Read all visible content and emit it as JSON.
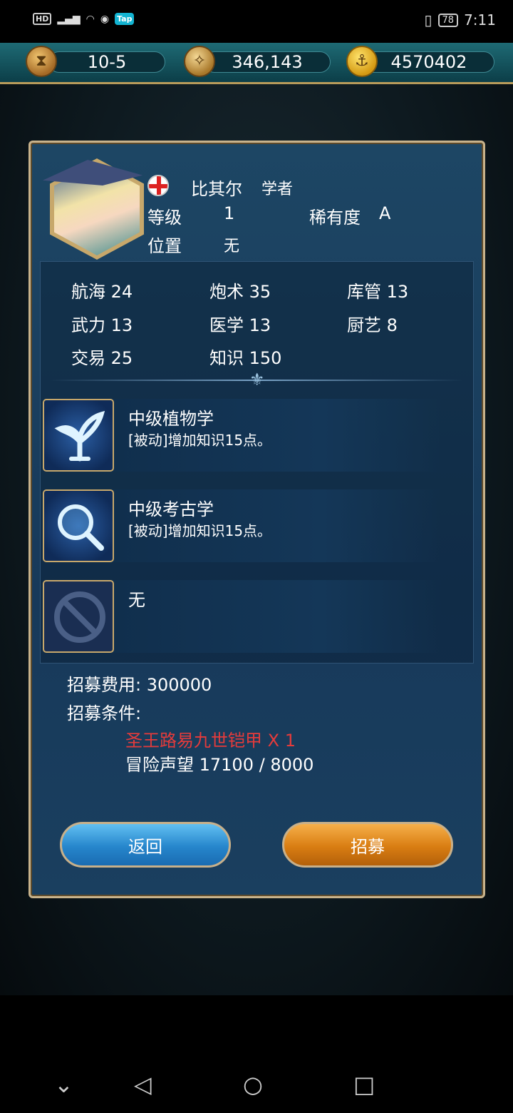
{
  "status_bar": {
    "hd": "HD",
    "tap": "Tap",
    "battery": "78",
    "time": "7:11"
  },
  "resources": {
    "stage": "10-5",
    "silver": "346,143",
    "gold": "4570402"
  },
  "character": {
    "name": "比其尔",
    "profession": "学者",
    "level_label": "等级",
    "level": "1",
    "rarity_label": "稀有度",
    "rarity": "A",
    "position_label": "位置",
    "position": "无"
  },
  "stats": {
    "navigation": "航海 24",
    "gunnery": "炮术 35",
    "storage": "库管 13",
    "force": "武力 13",
    "medicine": "医学 13",
    "cooking": "厨艺 8",
    "trade": "交易 25",
    "knowledge": "知识 150"
  },
  "skills": [
    {
      "name": "中级植物学",
      "desc": "[被动]增加知识15点。",
      "icon": "plant-icon"
    },
    {
      "name": "中级考古学",
      "desc": "[被动]增加知识15点。",
      "icon": "magnifier-icon"
    },
    {
      "name": "无",
      "desc": "",
      "icon": "empty-slot-icon"
    }
  ],
  "recruit": {
    "cost": "招募费用: 300000",
    "conditions_label": "招募条件:",
    "condition_1": "圣王路易九世铠甲 X 1",
    "condition_2": "冒险声望 17100 / 8000"
  },
  "buttons": {
    "back": "返回",
    "recruit": "招募"
  },
  "colors": {
    "panel": "#17395a",
    "condition_unmet": "#e53b3b",
    "back_button": "#2686cc",
    "recruit_button": "#d97d12"
  }
}
